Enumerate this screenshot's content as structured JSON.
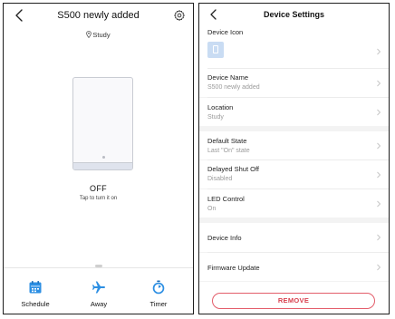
{
  "left": {
    "title": "S500 newly added",
    "location": "Study",
    "state": "OFF",
    "hint": "Tap to turn it on",
    "tabs": [
      {
        "label": "Schedule",
        "icon": "calendar-icon"
      },
      {
        "label": "Away",
        "icon": "airplane-icon"
      },
      {
        "label": "Timer",
        "icon": "timer-icon"
      }
    ]
  },
  "right": {
    "title": "Device Settings",
    "rows": {
      "device_icon": {
        "title": "Device Icon"
      },
      "device_name": {
        "title": "Device Name",
        "value": "S500 newly added"
      },
      "location": {
        "title": "Location",
        "value": "Study"
      },
      "default_state": {
        "title": "Default State",
        "value": "Last \"On\" state"
      },
      "delayed_shut_off": {
        "title": "Delayed Shut Off",
        "value": "Disabled"
      },
      "led_control": {
        "title": "LED Control",
        "value": "On"
      },
      "device_info": {
        "title": "Device Info"
      },
      "firmware_update": {
        "title": "Firmware Update"
      }
    },
    "remove_label": "REMOVE"
  },
  "colors": {
    "accent_blue": "#2d8fe3",
    "remove_red": "#d9414f",
    "section_gap": "#f3f3f3"
  }
}
